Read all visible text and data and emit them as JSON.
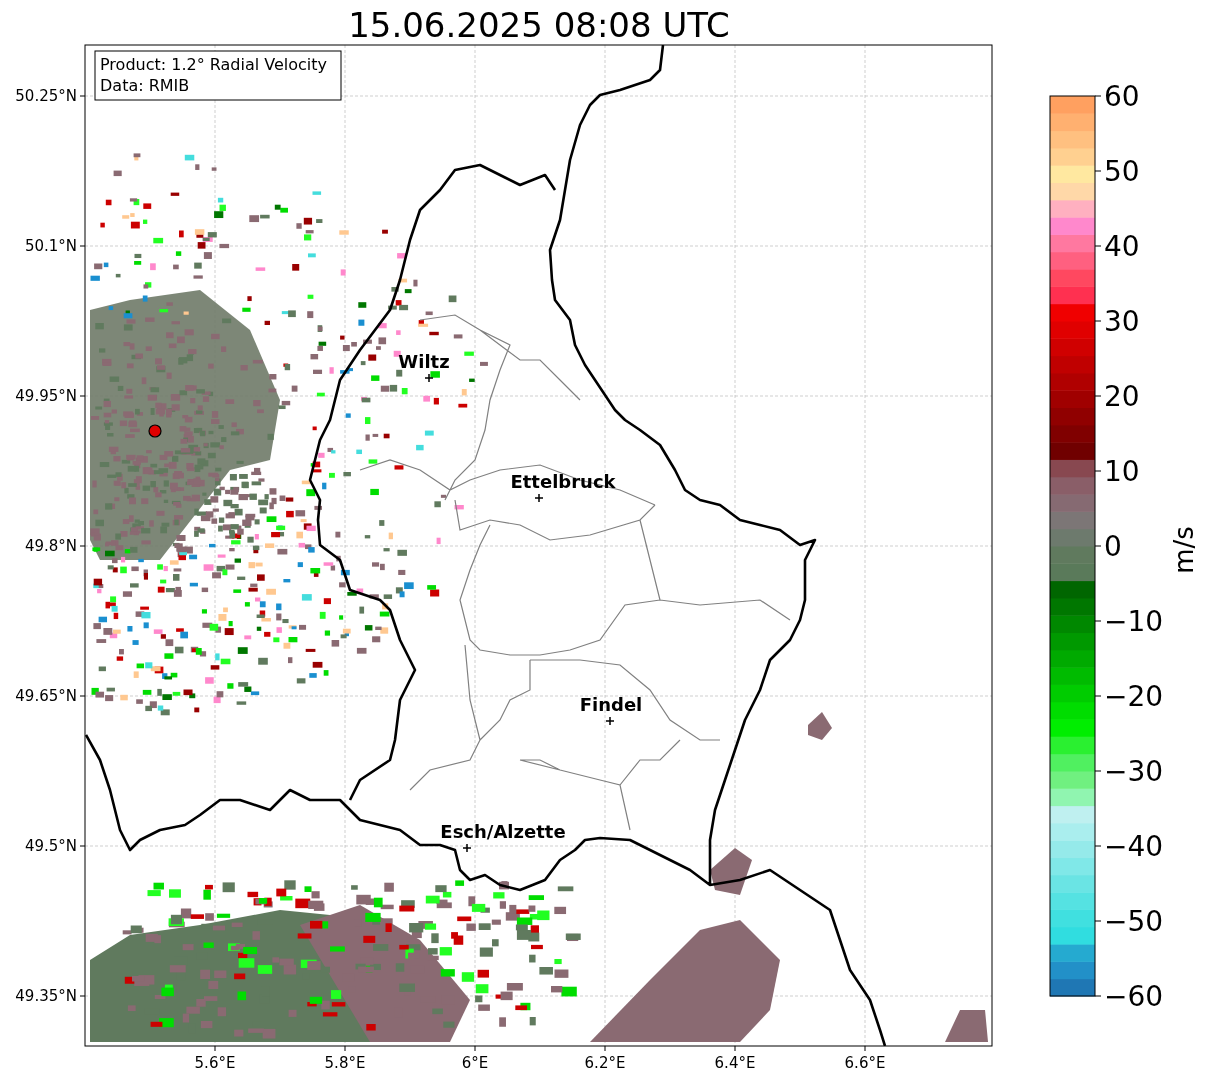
{
  "title": "15.06.2025 08:08 UTC",
  "info_box": [
    "Product: 1.2° Radial Velocity",
    "Data: RMIB"
  ],
  "map": {
    "cities": [
      {
        "name": "Wiltz"
      },
      {
        "name": "Ettelbruck"
      },
      {
        "name": "Findel"
      },
      {
        "name": "Esch/Alzette"
      }
    ],
    "lat_ticks": [
      "50.25°N",
      "50.1°N",
      "49.95°N",
      "49.8°N",
      "49.65°N",
      "49.5°N",
      "49.35°N"
    ],
    "lon_ticks": [
      "5.6°E",
      "5.8°E",
      "6°E",
      "6.2°E",
      "6.4°E",
      "6.6°E"
    ]
  },
  "colorbar": {
    "label": "m/s",
    "ticks": [
      "60",
      "50",
      "40",
      "30",
      "20",
      "10",
      "0",
      "−10",
      "−20",
      "−30",
      "−40",
      "−50",
      "−60"
    ]
  }
}
